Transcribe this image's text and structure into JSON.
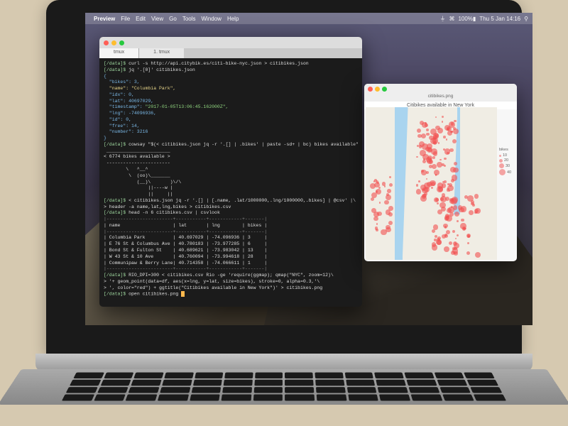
{
  "menubar": {
    "app": "Preview",
    "items": [
      "File",
      "Edit",
      "View",
      "Go",
      "Tools",
      "Window",
      "Help"
    ],
    "status_time": "Thu 5 Jan 14:16"
  },
  "terminal": {
    "tabs": [
      "tmux",
      "1. tmux"
    ],
    "prompt": "[/data]$",
    "lines": {
      "l1": " curl -s http://api.citybik.es/citi-bike-nyc.json > citibikes.json",
      "l2": " jq '.[0]' citibikes.json",
      "j_open": "{",
      "j_bikes": "  \"bikes\": 3,",
      "j_name": "  \"name\": \"Columbia Park\",",
      "j_idx": "  \"idx\": 0,",
      "j_lat": "  \"lat\": 40697029,",
      "j_ts_k": "  \"timestamp\": ",
      "j_ts_v": "\"2017-01-05T13:06:45.162000Z\",",
      "j_lng": "  \"lng\": -74096936,",
      "j_id": "  \"id\": 0,",
      "j_free": "  \"free\": 14,",
      "j_num": "  \"number\": 3216",
      "j_close": "}",
      "cowsay_cmd": " cowsay \"$(< citibikes.json jq -r '.[] | .bikes' | paste -sd+ | bc) bikes available\"",
      "cow_top": " _______________________",
      "cow_msg": "< 6774 bikes available >",
      "cow_bot": " -----------------------",
      "cow1": "        \\   ^__^",
      "cow2": "         \\  (oo)\\_______",
      "cow3": "            (__)\\       )\\/\\",
      "cow4": "                ||----w |",
      "cow5": "                ||     ||",
      "csv1": " < citibikes.json jq -r '.[] | [.name, .lat/1000000,.lng/1000000,.bikes] | @csv' |\\",
      "csv2": "> header -a name,lat,lng,bikes > citibikes.csv",
      "head_cmd": " head -n 6 citibikes.csv | csvlook",
      "t_rule": "|------------------------+-----------+------------+-------|",
      "t_hdr": "| name                   | lat       | lng        | bikes |",
      "t_r1": "| Columbia Park          | 40.697029 | -74.096936 | 3     |",
      "t_r2": "| E 76 St & Columbus Ave | 40.780183 | -73.977285 | 6     |",
      "t_r3": "| Bond St & Fulton St    | 40.689621 | -73.983042 | 13    |",
      "t_r4": "| W 43 St & 10 Ave       | 40.760094 | -73.994618 | 28    |",
      "t_r5": "| Communipaw & Berry Lane| 40.714358 | -74.066611 | 1     |",
      "rio1": " RIO_DPI=300 < citibikes.csv Rio -ge 'require(ggmap); qmap(\"NYC\", zoom=12)\\",
      "rio2": "> '+ geom_point(data=df, aes(x=lng, y=lat, size=bikes), stroke=0, alpha=0.3,'\\",
      "rio3": "> ', color=\"red\") + ggtitle(\"Citibikes available in New York\")' > citibikes.png",
      "open": " open citibikes.png "
    }
  },
  "preview": {
    "filename": "citibikes.png",
    "plot_title": "Citibikes available in New York",
    "legend_title": "bikes",
    "legend": [
      "10",
      "20",
      "30",
      "40"
    ]
  },
  "chart_data": {
    "type": "scatter",
    "title": "Citibikes available in New York",
    "basemap": "NYC google map, zoom 12",
    "encoding": {
      "x": "lng",
      "y": "lat",
      "size": "bikes",
      "color": "red",
      "alpha": 0.3
    },
    "legend_sizes": [
      10,
      20,
      30,
      40
    ],
    "sample_points": [
      {
        "name": "Columbia Park",
        "lat": 40.697029,
        "lng": -74.096936,
        "bikes": 3
      },
      {
        "name": "E 76 St & Columbus Ave",
        "lat": 40.780183,
        "lng": -73.977285,
        "bikes": 6
      },
      {
        "name": "Bond St & Fulton St",
        "lat": 40.689621,
        "lng": -73.983042,
        "bikes": 13
      },
      {
        "name": "W 43 St & 10 Ave",
        "lat": 40.760094,
        "lng": -73.994618,
        "bikes": 28
      },
      {
        "name": "Communipaw & Berry Lane",
        "lat": 40.714358,
        "lng": -74.066611,
        "bikes": 1
      }
    ],
    "total_bikes": 6774
  }
}
